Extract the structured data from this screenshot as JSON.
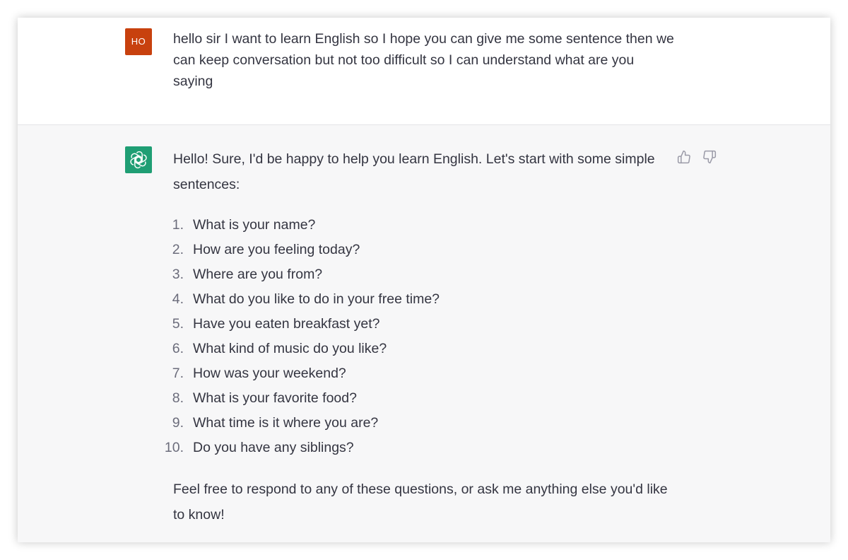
{
  "colors": {
    "user_avatar_bg": "#c8410e",
    "bot_avatar_bg": "#1f9e74",
    "text": "#343541",
    "assistant_bg": "#f7f7f8",
    "icon": "#9a9aa7"
  },
  "user_message": {
    "avatar_initials": "HO",
    "text": "hello sir I want to learn English so I hope you can give me some sentence then we can keep conversation but not too difficult so I can understand what are you saying"
  },
  "assistant_message": {
    "avatar_icon": "openai-logo-icon",
    "intro": "Hello! Sure, I'd be happy to help you learn English. Let's start with some simple sentences:",
    "questions": [
      {
        "num": "1.",
        "text": "What is your name?"
      },
      {
        "num": "2.",
        "text": "How are you feeling today?"
      },
      {
        "num": "3.",
        "text": "Where are you from?"
      },
      {
        "num": "4.",
        "text": "What do you like to do in your free time?"
      },
      {
        "num": "5.",
        "text": "Have you eaten breakfast yet?"
      },
      {
        "num": "6.",
        "text": "What kind of music do you like?"
      },
      {
        "num": "7.",
        "text": "How was your weekend?"
      },
      {
        "num": "8.",
        "text": "What is your favorite food?"
      },
      {
        "num": "9.",
        "text": "What time is it where you are?"
      },
      {
        "num": "10.",
        "text": "Do you have any siblings?"
      }
    ],
    "outro": "Feel free to respond to any of these questions, or ask me anything else you'd like to know!",
    "feedback_icons": [
      "thumbs-up-icon",
      "thumbs-down-icon"
    ]
  }
}
